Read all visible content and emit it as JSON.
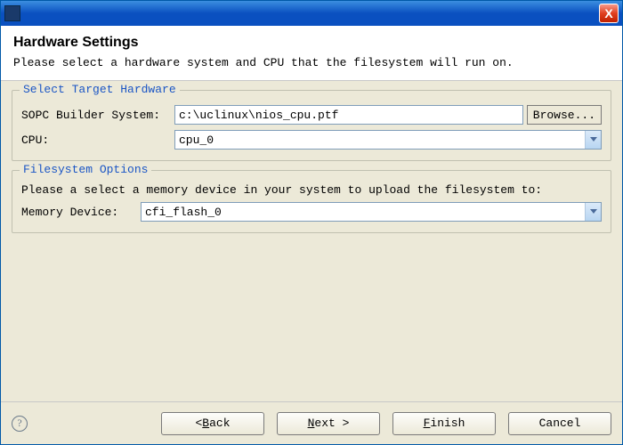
{
  "header": {
    "title": "Hardware Settings",
    "subtitle": "Please select a hardware system and CPU that the filesystem will run on."
  },
  "group_hw": {
    "legend": "Select Target Hardware",
    "sopc_label": "SOPC Builder System:",
    "sopc_value": "c:\\uclinux\\nios_cpu.ptf",
    "browse_label": "Browse...",
    "cpu_label": "CPU:",
    "cpu_value": "cpu_0"
  },
  "group_fs": {
    "legend": "Filesystem Options",
    "desc": "Please a select a memory device in your system to upload the filesystem to:",
    "mem_label": "Memory Device:",
    "mem_value": "cfi_flash_0"
  },
  "footer": {
    "back_prefix": "< ",
    "back_u": "B",
    "back_rest": "ack",
    "next_u": "N",
    "next_rest": "ext >",
    "finish_u": "F",
    "finish_rest": "inish",
    "cancel": "Cancel",
    "help_char": "?"
  },
  "close_char": "X"
}
